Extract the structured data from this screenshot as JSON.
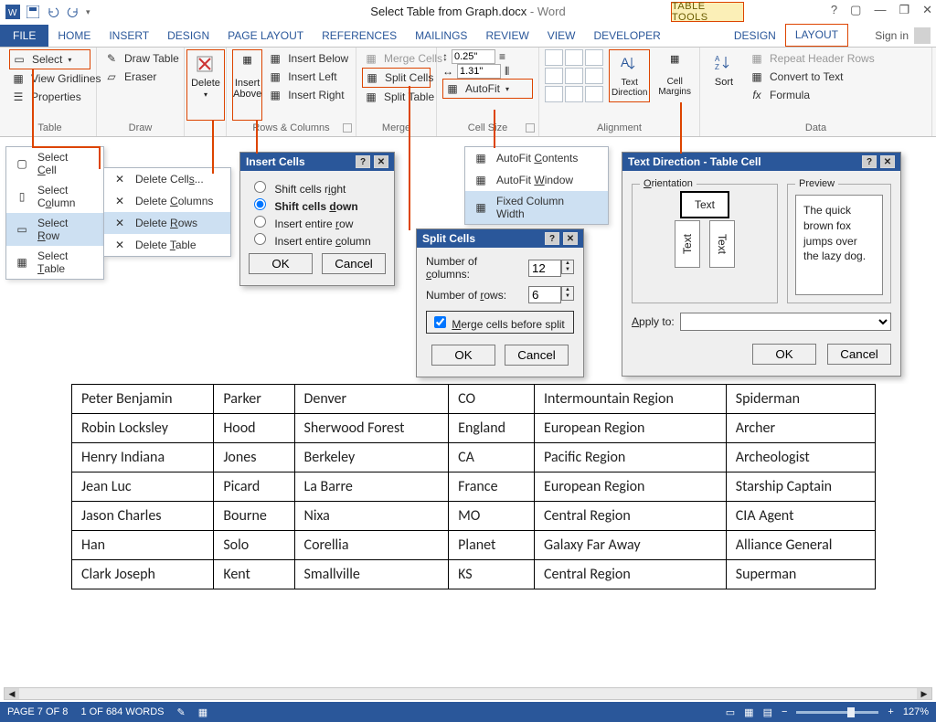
{
  "titlebar": {
    "doc_name": "Select Table from Graph.docx",
    "app_name": "Word",
    "table_tools": "TABLE TOOLS"
  },
  "ribbon_tabs": {
    "file": "FILE",
    "home": "HOME",
    "insert": "INSERT",
    "design": "DESIGN",
    "page_layout": "PAGE LAYOUT",
    "references": "REFERENCES",
    "mailings": "MAILINGS",
    "review": "REVIEW",
    "view": "VIEW",
    "developer": "DEVELOPER",
    "design2": "DESIGN",
    "layout": "LAYOUT",
    "signin": "Sign in"
  },
  "ribbon": {
    "table_group": "Table",
    "select": "Select",
    "view_gridlines": "View Gridlines",
    "properties": "Properties",
    "draw_group": "Draw",
    "draw_table": "Draw Table",
    "eraser": "Eraser",
    "delete": "Delete",
    "insert_above": "Insert Above",
    "insert_below": "Insert Below",
    "insert_left": "Insert Left",
    "insert_right": "Insert Right",
    "rows_cols": "Rows & Columns",
    "merge_group": "Merge",
    "merge_cells": "Merge Cells",
    "split_cells": "Split Cells",
    "split_table": "Split Table",
    "cell_size_group": "Cell Size",
    "height_val": "0.25\"",
    "width_val": "1.31\"",
    "autofit": "AutoFit",
    "alignment_group": "Alignment",
    "text_direction": "Text Direction",
    "cell_margins": "Cell Margins",
    "data_group": "Data",
    "sort": "Sort",
    "repeat_header": "Repeat Header Rows",
    "convert_text": "Convert to Text",
    "formula": "Formula"
  },
  "select_menu": {
    "cell": "Select Cell",
    "column": "Select Column",
    "row": "Select Row",
    "table": "Select Table"
  },
  "delete_menu": {
    "cells": "Delete Cells...",
    "columns": "Delete Columns",
    "rows": "Delete Rows",
    "table": "Delete Table"
  },
  "autofit_menu": {
    "contents": "AutoFit Contents",
    "window": "AutoFit Window",
    "fixed": "Fixed Column Width"
  },
  "dlg_insert": {
    "title": "Insert Cells",
    "opt_right": "Shift cells right",
    "opt_down": "Shift cells down",
    "opt_row": "Insert entire row",
    "opt_col": "Insert entire column",
    "ok": "OK",
    "cancel": "Cancel"
  },
  "dlg_split": {
    "title": "Split Cells",
    "cols_label": "Number of columns:",
    "cols_val": "12",
    "rows_label": "Number of rows:",
    "rows_val": "6",
    "merge_before": "Merge cells before split",
    "ok": "OK",
    "cancel": "Cancel"
  },
  "dlg_textdir": {
    "title": "Text Direction - Table Cell",
    "orientation": "Orientation",
    "preview": "Preview",
    "text_btn": "Text",
    "text_vert": "Text",
    "preview_text": "The quick brown fox jumps over the lazy dog.",
    "apply_to": "Apply to:",
    "ok": "OK",
    "cancel": "Cancel"
  },
  "table": {
    "rows": [
      [
        "Peter Benjamin",
        "Parker",
        "Denver",
        "CO",
        "Intermountain Region",
        "Spiderman"
      ],
      [
        "Robin Locksley",
        "Hood",
        "Sherwood Forest",
        "England",
        "European Region",
        "Archer"
      ],
      [
        "Henry Indiana",
        "Jones",
        "Berkeley",
        "CA",
        "Pacific Region",
        "Archeologist"
      ],
      [
        "Jean Luc",
        "Picard",
        "La Barre",
        "France",
        "European Region",
        "Starship Captain"
      ],
      [
        "Jason Charles",
        "Bourne",
        "Nixa",
        "MO",
        "Central Region",
        "CIA Agent"
      ],
      [
        "Han",
        "Solo",
        "Corellia",
        "Planet",
        "Galaxy Far Away",
        "Alliance General"
      ],
      [
        "Clark Joseph",
        "Kent",
        "Smallville",
        "KS",
        "Central Region",
        "Superman"
      ]
    ]
  },
  "status": {
    "page": "PAGE 7 OF 8",
    "words": "1 OF 684 WORDS",
    "zoom": "127%"
  }
}
